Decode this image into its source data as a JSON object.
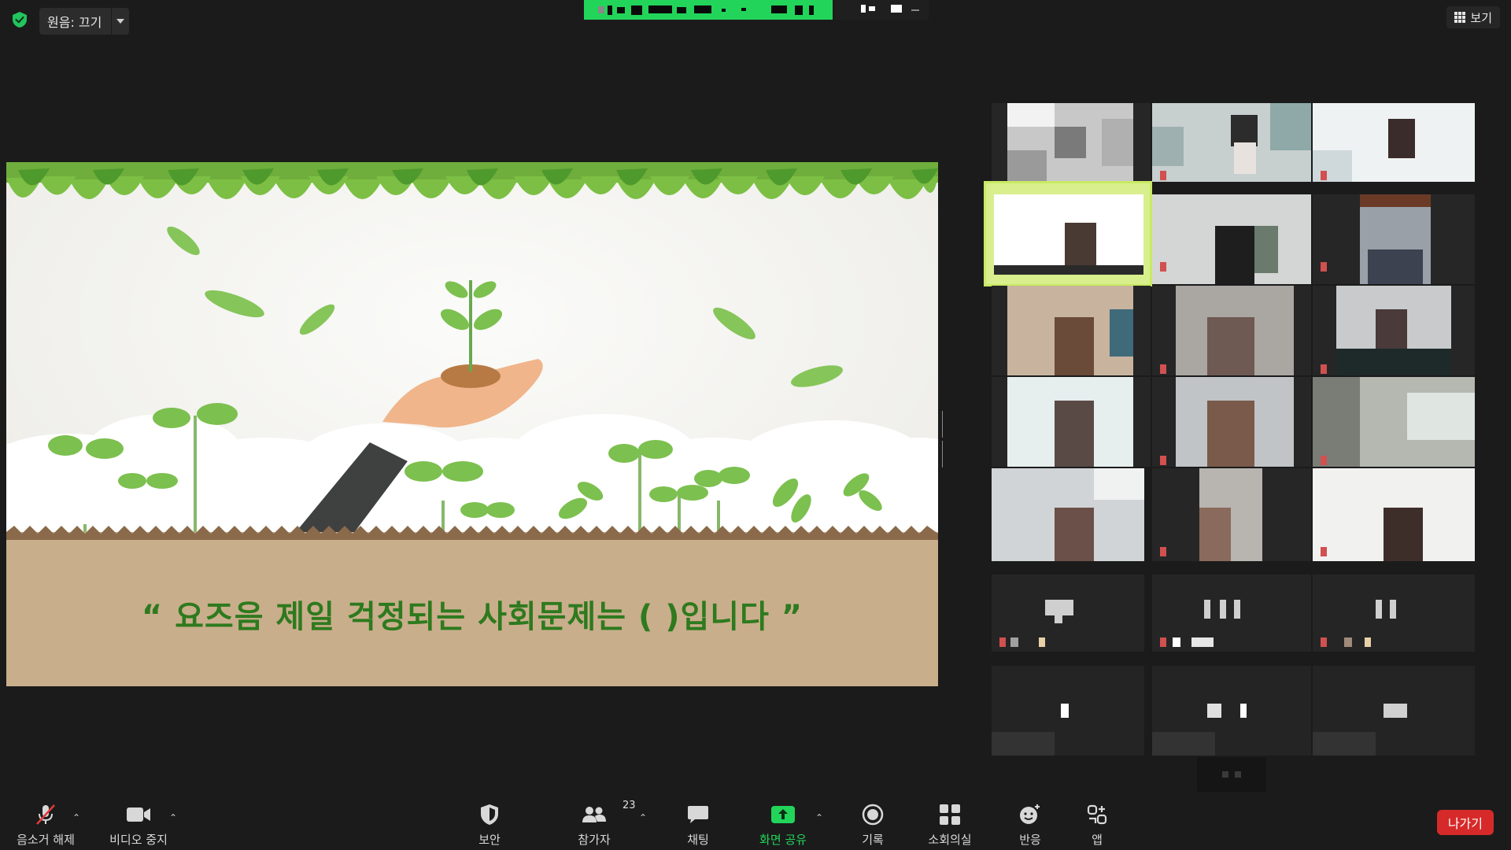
{
  "topbar": {
    "original_sound_label": "원음: 끄기",
    "view_label": "보기"
  },
  "slide": {
    "sentence": "“ 요즈음 제일 걱정되는 사회문제는  (         )입니다 ”"
  },
  "toolbar": {
    "unmute_label": "음소거 해제",
    "stop_video_label": "비디오 중지",
    "security_label": "보안",
    "participants_label": "참가자",
    "participants_count": "23",
    "chat_label": "채팅",
    "share_screen_label": "화면 공유",
    "record_label": "기록",
    "breakout_label": "소회의실",
    "reactions_label": "반응",
    "apps_label": "앱",
    "leave_label": "나가기"
  },
  "colors": {
    "share_green": "#23d45a",
    "leave_red": "#d62a2a",
    "slide_text_green": "#2e7a1e",
    "active_speaker_border": "#c8ea64"
  }
}
